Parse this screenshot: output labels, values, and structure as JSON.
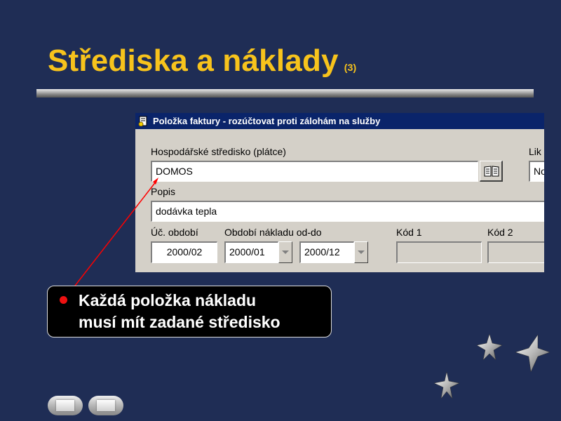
{
  "slide": {
    "title": "Střediska a náklady",
    "title_sub": "(3)",
    "colors": {
      "background": "#1f2d55",
      "title": "#f7c31c",
      "pointer": "#ff0000"
    }
  },
  "window": {
    "title": "Položka faktury - rozúčtovat proti zálohám na služby",
    "icon": "document-icon",
    "fields": {
      "stredisko": {
        "label": "Hospodářské středisko (plátce)",
        "value": "DOMOS"
      },
      "likvidace": {
        "label": "Lik",
        "value": "No"
      },
      "popis": {
        "label": "Popis",
        "value": "dodávka tepla"
      },
      "uc_obdobi": {
        "label": "Úč. období",
        "value": "2000/02"
      },
      "obdobi_nakladu": {
        "label": "Období nákladu od-do",
        "from": "2000/01",
        "to": "2000/12"
      },
      "kod1": {
        "label": "Kód 1",
        "value": ""
      },
      "kod2": {
        "label": "Kód 2",
        "value": ""
      }
    },
    "lookup_button_icon": "book-icon",
    "dropdown_icon": "chevron-down-icon"
  },
  "callout": {
    "line1": "Každá položka nákladu",
    "line2": "musí mít zadané středisko"
  },
  "navigation": {
    "prev_icon": "prev-slide-icon",
    "next_icon": "next-slide-icon"
  }
}
